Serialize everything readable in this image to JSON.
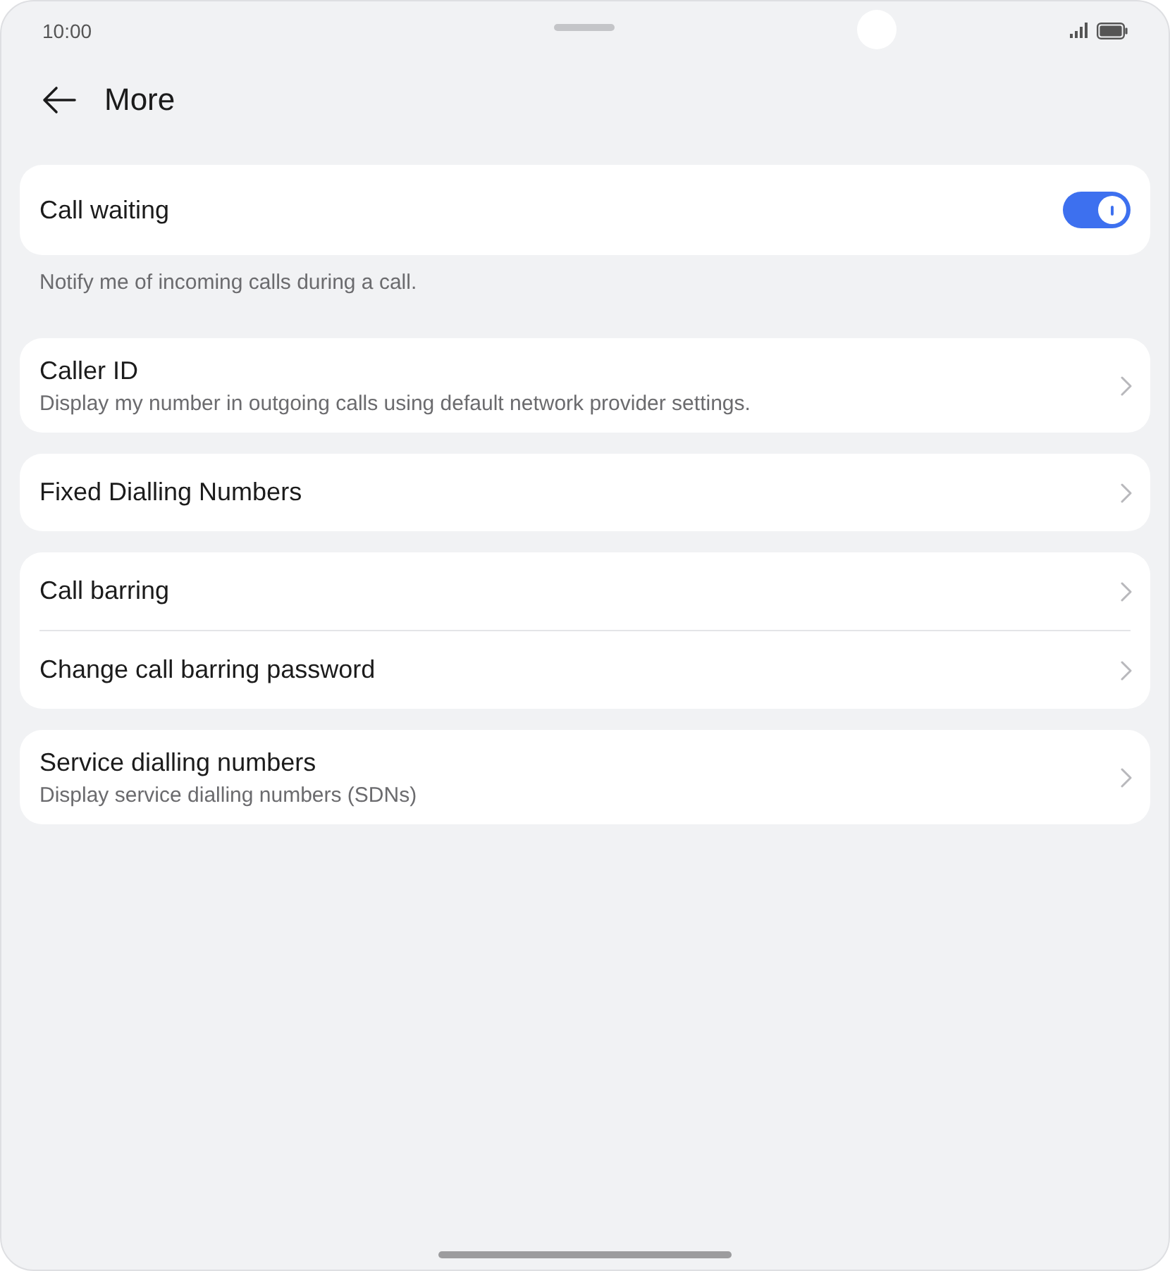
{
  "status_bar": {
    "time": "10:00"
  },
  "header": {
    "title": "More"
  },
  "groups": [
    {
      "items": [
        {
          "kind": "switch",
          "title": "Call waiting",
          "on": true
        }
      ],
      "footer": "Notify me of incoming calls during a call."
    },
    {
      "items": [
        {
          "kind": "link",
          "title": "Caller ID",
          "subtitle": "Display my number in outgoing calls using default network provider settings."
        }
      ]
    },
    {
      "items": [
        {
          "kind": "link",
          "title": "Fixed Dialling Numbers"
        }
      ]
    },
    {
      "items": [
        {
          "kind": "link",
          "title": "Call barring"
        },
        {
          "kind": "link",
          "title": "Change call barring password"
        }
      ]
    },
    {
      "items": [
        {
          "kind": "link",
          "title": "Service dialling numbers",
          "subtitle": "Display service dialling numbers (SDNs)"
        }
      ]
    }
  ]
}
